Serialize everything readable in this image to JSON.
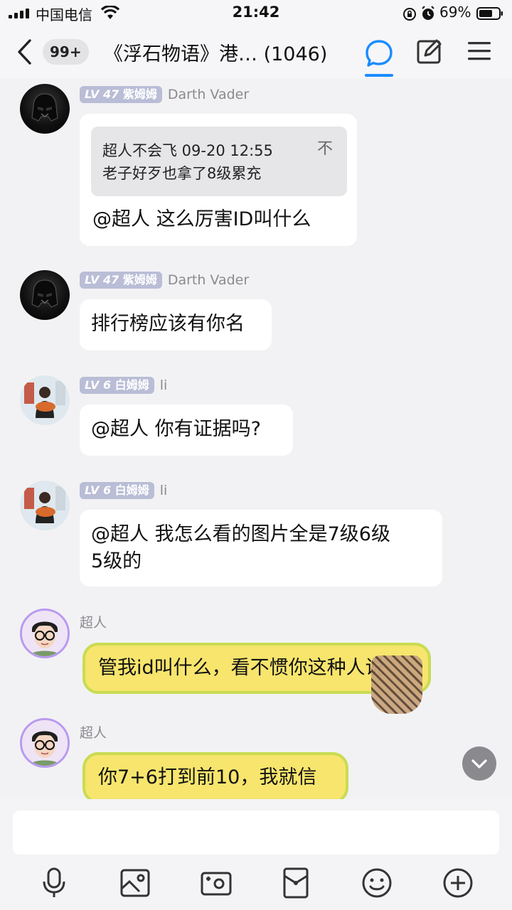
{
  "status_bar": {
    "carrier": "中国电信",
    "time": "21:42",
    "battery": "69%"
  },
  "nav": {
    "unread_count": "99+",
    "title": "《浮石物语》港…  (1046)"
  },
  "messages": [
    {
      "sender": "Darth Vader",
      "level_prefix": "LV",
      "level_num": "47",
      "rank": "紫姆姆",
      "quote": {
        "author_time": "超人不会飞 09-20 12:55",
        "text": "老子好歹也拿了8级累充",
        "pin_glyph": "不"
      },
      "text": "@超人  这么厉害ID叫什么"
    },
    {
      "sender": "Darth Vader",
      "level_prefix": "LV",
      "level_num": "47",
      "rank": "紫姆姆",
      "text": "排行榜应该有你名"
    },
    {
      "sender": "li",
      "level_prefix": "LV",
      "level_num": "6",
      "rank": "白姆姆",
      "text": "@超人 你有证据吗?"
    },
    {
      "sender": "li",
      "level_prefix": "LV",
      "level_num": "6",
      "rank": "白姆姆",
      "text_line1": "@超人 我怎么看的图片全是7级6级",
      "text_line2": "5级的"
    },
    {
      "sender": "超人",
      "text": "管我id叫什么，看不惯你这种人说"
    },
    {
      "sender": "超人",
      "text": "你7+6打到前10，我就信"
    }
  ],
  "colors": {
    "accent": "#1a8cff",
    "yellow_bubble": "#f7e56d",
    "level_badge": "#b9bdd6"
  },
  "icons": [
    "signal-icon",
    "wifi-icon",
    "rotation-lock-icon",
    "alarm-icon",
    "battery-icon",
    "back-icon",
    "chat-icon",
    "edit-icon",
    "menu-icon",
    "chevron-down-icon",
    "microphone-icon",
    "image-icon",
    "camera-icon",
    "red-packet-icon",
    "emoji-icon",
    "plus-icon"
  ]
}
